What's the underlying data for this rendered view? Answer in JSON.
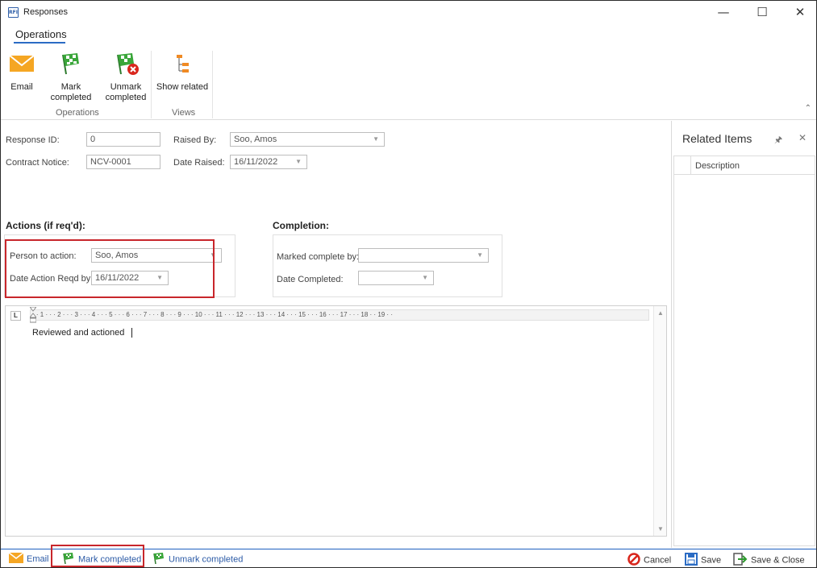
{
  "window": {
    "title": "Responses",
    "app_icon_text": "RFI",
    "minimize_glyph": "—",
    "maximize_glyph": "☐",
    "close_glyph": "✕"
  },
  "ribbon": {
    "tab": "Operations",
    "buttons": [
      {
        "label": "Email",
        "icon": "envelope-icon"
      },
      {
        "label": "Mark completed",
        "icon": "green-flag-icon"
      },
      {
        "label_line1": "Unmark",
        "label_line2": "completed",
        "icon": "flag-remove-icon"
      },
      {
        "label": "Show related",
        "icon": "hierarchy-icon"
      }
    ],
    "groups": [
      "Operations",
      "Views"
    ]
  },
  "form": {
    "response_id_label": "Response ID:",
    "response_id_value": "0",
    "raised_by_label": "Raised By:",
    "raised_by_value": "Soo, Amos",
    "contract_notice_label": "Contract Notice:",
    "contract_notice_value": "NCV-0001",
    "date_raised_label": "Date Raised:",
    "date_raised_value": "16/11/2022"
  },
  "actions": {
    "title": "Actions (if req'd):",
    "person_label": "Person to action:",
    "person_value": "Soo, Amos",
    "date_label": "Date Action Reqd by:",
    "date_value": "16/11/2022"
  },
  "completion": {
    "title": "Completion:",
    "marked_by_label": "Marked complete by:",
    "marked_by_value": "",
    "date_completed_label": "Date Completed:",
    "date_completed_value": ""
  },
  "editor": {
    "ruler_corner": "L",
    "ruler_text": "· · 1 · · · 2 · · · 3 · · · 4 · · · 5 · · · 6 · · · 7 · · · 8 · · · 9 · · · 10 · · · 11 · · · 12 · · · 13 · · · 14 · · · 15 · · · 16 · · · 17 · · · 18 · · 19 · ·",
    "content": "Reviewed and actioned"
  },
  "related": {
    "title": "Related Items",
    "pin_glyph": "🖈",
    "close_glyph": "✕",
    "column": "Description"
  },
  "bottom": {
    "email": "Email",
    "mark_completed": "Mark completed",
    "unmark_completed": "Unmark completed",
    "cancel": "Cancel",
    "save": "Save",
    "save_close": "Save & Close"
  },
  "colors": {
    "accent": "#2b6cc4",
    "highlight_box": "#c8262b",
    "flag_green": "#3aa63a",
    "envelope_orange": "#f5a623",
    "cancel_red": "#d9261c"
  }
}
